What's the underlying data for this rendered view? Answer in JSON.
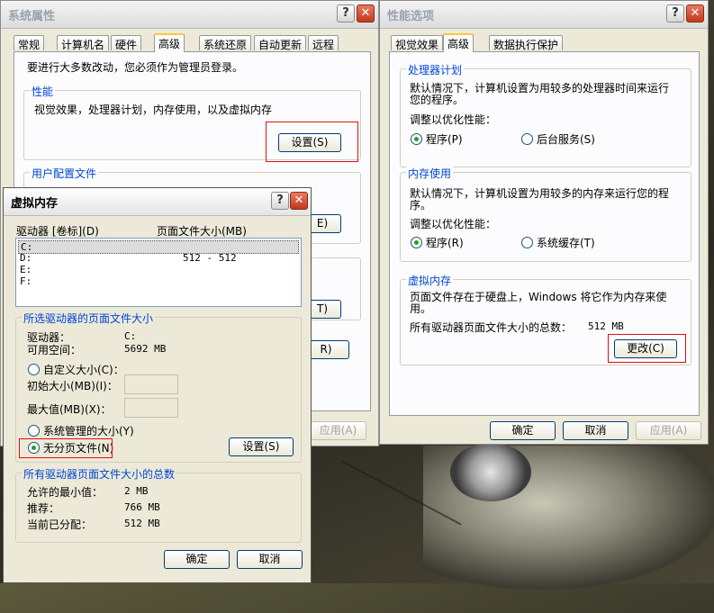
{
  "sysprops": {
    "title": "系统属性",
    "help": "?",
    "close": "✕",
    "tabs": [
      "常规",
      "计算机名",
      "硬件",
      "高级",
      "系统还原",
      "自动更新",
      "远程"
    ],
    "admin_note": "要进行大多数改动，您必须作为管理员登录。",
    "perf_group": "性能",
    "perf_desc": "视觉效果，处理器计划，内存使用，以及虚拟内存",
    "settings_btn": "设置(S)",
    "profile_group": "用户配置文件",
    "hidden_btn_e": "E)",
    "hidden_btn_t": "T)",
    "hidden_btn_r": "R)",
    "apply_btn": "应用(A)"
  },
  "perfopts": {
    "title": "性能选项",
    "help": "?",
    "close": "✕",
    "tabs": [
      "视觉效果",
      "高级",
      "数据执行保护"
    ],
    "cpu_group": "处理器计划",
    "cpu_desc_1": "默认情况下，计算机设置为用较多的处理器时间来运行",
    "cpu_desc_2": "您的程序。",
    "optimize_label": "调整以优化性能：",
    "cpu_opt_programs": "程序(P)",
    "cpu_opt_services": "后台服务(S)",
    "mem_group": "内存使用",
    "mem_desc_1": "默认情况下，计算机设置为用较多的内存来运行您的程",
    "mem_desc_2": "序。",
    "mem_opt_programs": "程序(R)",
    "mem_opt_cache": "系统缓存(T)",
    "vm_group": "虚拟内存",
    "vm_desc_1": "页面文件存在于硬盘上，Windows 将它作为内存来使",
    "vm_desc_2": "用。",
    "vm_total_label": "所有驱动器页面文件大小的总数：",
    "vm_total_value": "512 MB",
    "change_btn": "更改(C)",
    "ok_btn": "确定",
    "cancel_btn": "取消",
    "apply_btn": "应用(A)"
  },
  "vm": {
    "title": "虚拟内存",
    "help": "?",
    "close": "✕",
    "col_drive": "驱动器 [卷标](D)",
    "col_size": "页面文件大小(MB)",
    "drives": [
      {
        "drive": "C:",
        "size": ""
      },
      {
        "drive": "D:",
        "size": "512 - 512"
      },
      {
        "drive": "E:",
        "size": ""
      },
      {
        "drive": "F:",
        "size": ""
      }
    ],
    "sel_group": "所选驱动器的页面文件大小",
    "drive_label": "驱动器：",
    "drive_value": "C:",
    "space_label": "可用空间：",
    "space_value": "5692 MB",
    "custom_size": "自定义大小(C)：",
    "initial_size": "初始大小(MB)(I)：",
    "max_size": "最大值(MB)(X)：",
    "system_managed": "系统管理的大小(Y)",
    "no_paging": "无分页文件(N)",
    "set_btn": "设置(S)",
    "total_group": "所有驱动器页面文件大小的总数",
    "min_label": "允许的最小值：",
    "min_value": "2 MB",
    "rec_label": "推荐：",
    "rec_value": "766 MB",
    "cur_label": "当前已分配：",
    "cur_value": "512 MB",
    "ok_btn": "确定",
    "cancel_btn": "取消"
  }
}
